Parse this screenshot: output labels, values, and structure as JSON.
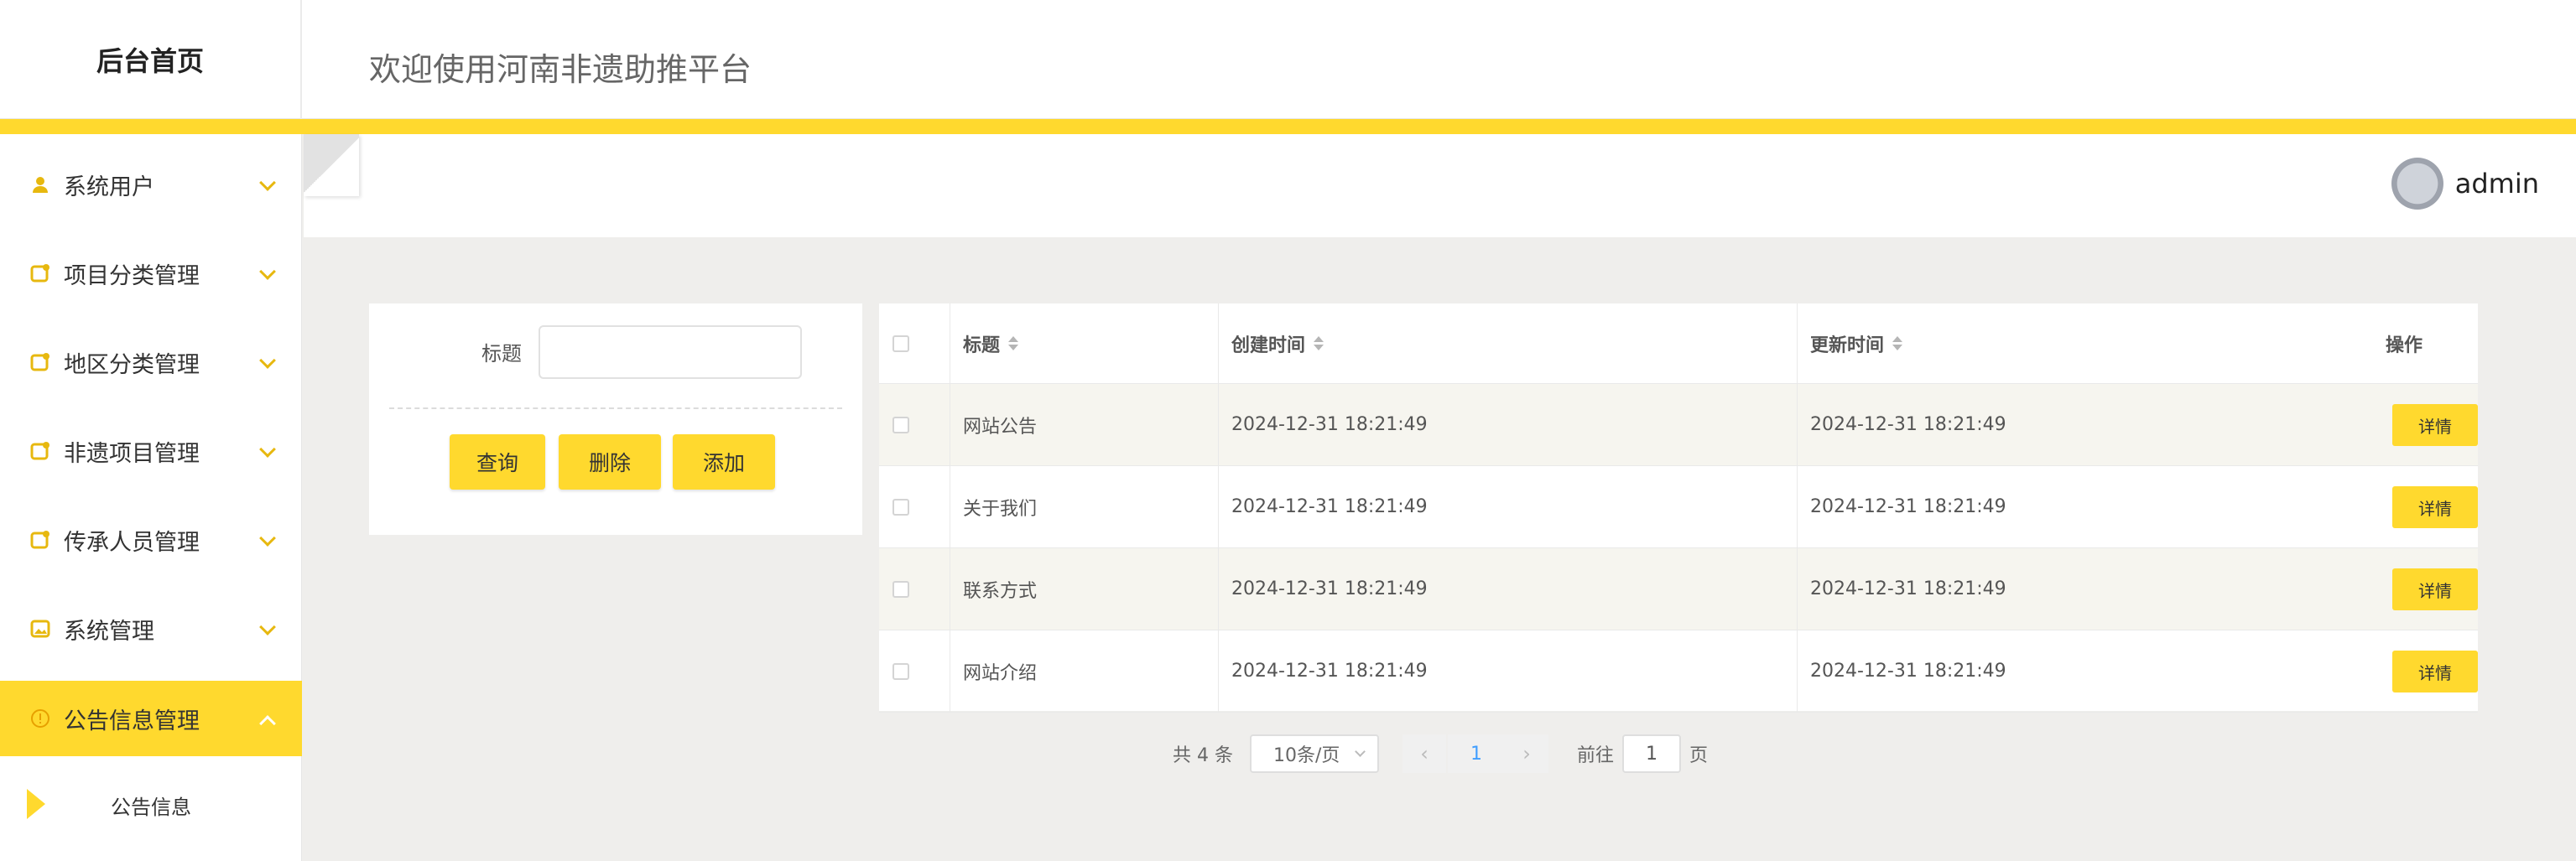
{
  "header": {
    "brand": "后台首页",
    "welcome": "欢迎使用河南非遗助推平台"
  },
  "user": {
    "name": "admin"
  },
  "sidebar": {
    "items": [
      {
        "label": "系统用户",
        "icon": "user-icon"
      },
      {
        "label": "项目分类管理",
        "icon": "folder-icon"
      },
      {
        "label": "地区分类管理",
        "icon": "folder-icon"
      },
      {
        "label": "非遗项目管理",
        "icon": "folder-icon"
      },
      {
        "label": "传承人员管理",
        "icon": "folder-icon"
      },
      {
        "label": "系统管理",
        "icon": "image-icon"
      },
      {
        "label": "公告信息管理",
        "icon": "info-icon",
        "active": true
      }
    ],
    "sub_item": "公告信息"
  },
  "search": {
    "title_label": "标题",
    "title_value": "",
    "query_btn": "查询",
    "delete_btn": "删除",
    "add_btn": "添加"
  },
  "table": {
    "columns": {
      "title": "标题",
      "created": "创建时间",
      "updated": "更新时间",
      "action": "操作"
    },
    "rows": [
      {
        "title": "网站公告",
        "created": "2024-12-31 18:21:49",
        "updated": "2024-12-31 18:21:49",
        "action": "详情"
      },
      {
        "title": "关于我们",
        "created": "2024-12-31 18:21:49",
        "updated": "2024-12-31 18:21:49",
        "action": "详情"
      },
      {
        "title": "联系方式",
        "created": "2024-12-31 18:21:49",
        "updated": "2024-12-31 18:21:49",
        "action": "详情"
      },
      {
        "title": "网站介绍",
        "created": "2024-12-31 18:21:49",
        "updated": "2024-12-31 18:21:49",
        "action": "详情"
      }
    ]
  },
  "pagination": {
    "total": "共 4 条",
    "page_size": "10条/页",
    "current_page": "1",
    "goto_label": "前往",
    "goto_value": "1",
    "page_suffix": "页"
  },
  "colors": {
    "accent": "#ffd92e",
    "page_bg": "#efeeec"
  }
}
